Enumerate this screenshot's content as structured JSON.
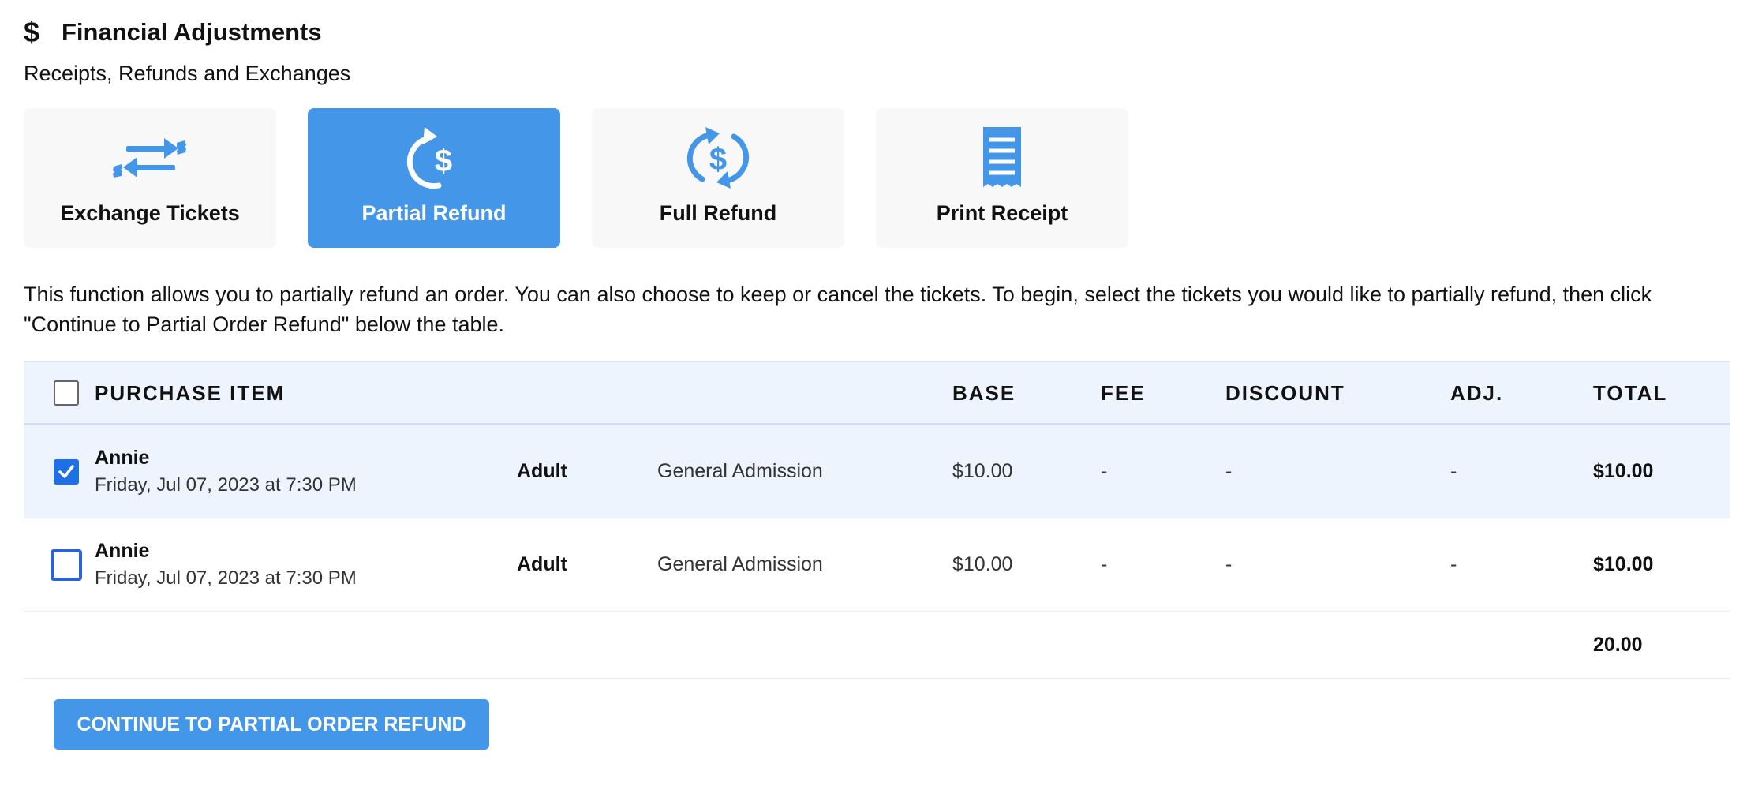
{
  "header": {
    "icon": "dollar-icon",
    "icon_glyph": "$",
    "title": "Financial Adjustments",
    "subtitle": "Receipts, Refunds and Exchanges"
  },
  "tiles": [
    {
      "label": "Exchange Tickets",
      "icon": "exchange-tickets-icon",
      "active": false
    },
    {
      "label": "Partial Refund",
      "icon": "partial-refund-icon",
      "active": true
    },
    {
      "label": "Full Refund",
      "icon": "full-refund-icon",
      "active": false
    },
    {
      "label": "Print Receipt",
      "icon": "receipt-icon",
      "active": false
    }
  ],
  "description": "This function allows you to partially refund an order. You can also choose to keep or cancel the tickets. To begin, select the tickets you would like to partially refund, then click \"Continue to Partial Order Refund\" below the table.",
  "table": {
    "headers": {
      "item": "PURCHASE ITEM",
      "base": "BASE",
      "fee": "FEE",
      "discount": "DISCOUNT",
      "adj": "ADJ.",
      "total": "TOTAL"
    },
    "rows": [
      {
        "name": "Annie",
        "date": "Friday, Jul 07, 2023 at 7:30 PM",
        "type": "Adult",
        "section": "General Admission",
        "base": "$10.00",
        "fee": "-",
        "discount": "-",
        "adj": "-",
        "total": "$10.00",
        "checked": true
      },
      {
        "name": "Annie",
        "date": "Friday, Jul 07, 2023 at 7:30 PM",
        "type": "Adult",
        "section": "General Admission",
        "base": "$10.00",
        "fee": "-",
        "discount": "-",
        "adj": "-",
        "total": "$10.00",
        "checked": false
      }
    ],
    "grand_total": "20.00"
  },
  "continue_button": "CONTINUE TO PARTIAL ORDER REFUND",
  "colors": {
    "accent": "#4496e8",
    "checkbox": "#1f6fe5",
    "header_bg": "#edf4fd",
    "tile_bg": "#f8f8f8"
  }
}
